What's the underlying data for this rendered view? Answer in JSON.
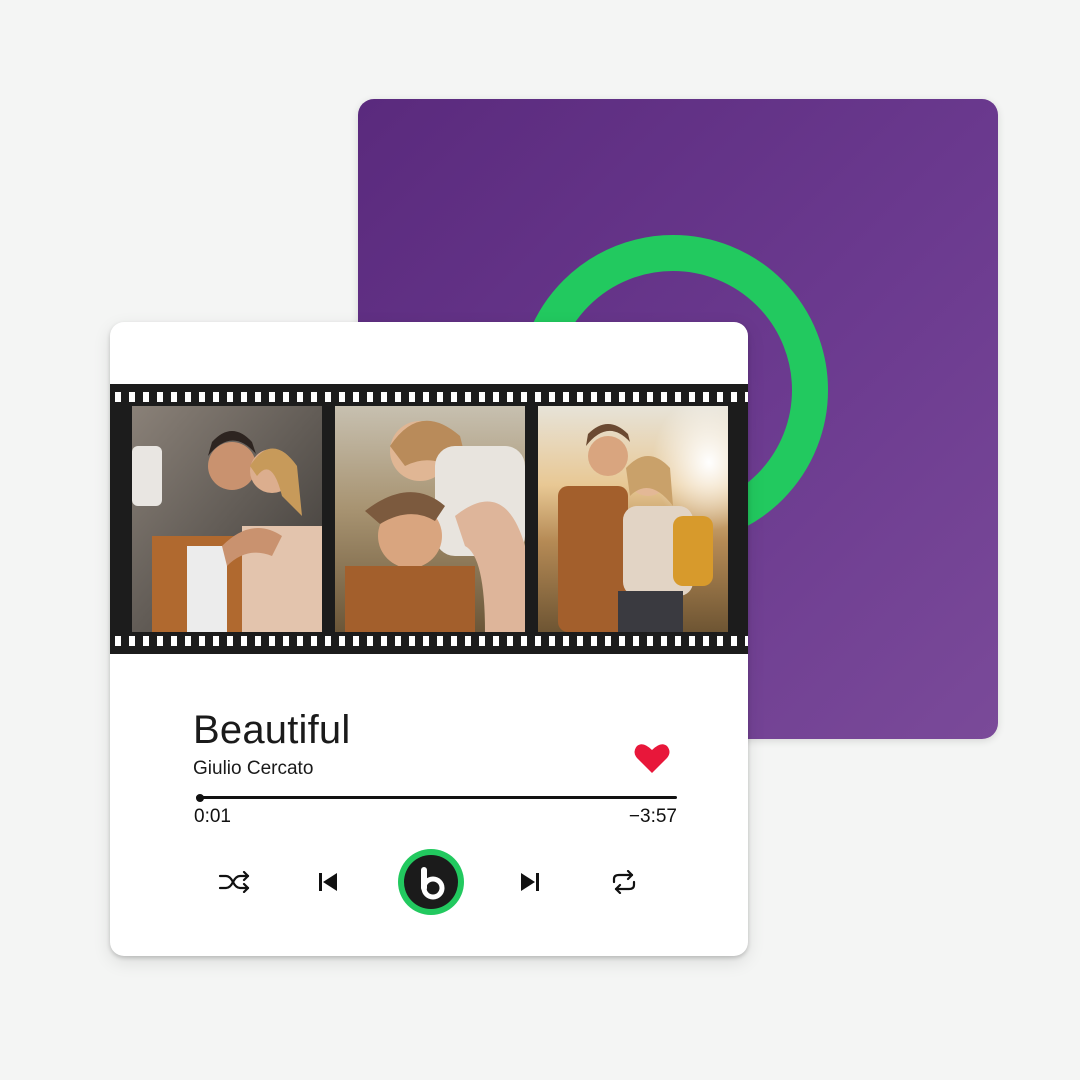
{
  "back_plaque": {
    "background_color": "#6b3a8f",
    "ring_color": "#22c95f",
    "icon": "ring-logo-icon"
  },
  "player": {
    "photos": [
      {
        "icon": "couple-kissing-photo"
      },
      {
        "icon": "couple-selfie-photo"
      },
      {
        "icon": "couple-hugging-photo"
      }
    ],
    "title": "Beautiful",
    "artist": "Giulio Cercato",
    "liked_color": "#e8173a",
    "progress": 0.004,
    "time_elapsed": "0:01",
    "time_remaining": "−3:57",
    "controls": {
      "shuffle": "shuffle-icon",
      "previous": "previous-track-icon",
      "play": "play-logo-icon",
      "next": "next-track-icon",
      "repeat": "repeat-icon"
    },
    "accent_color": "#22c95f"
  }
}
